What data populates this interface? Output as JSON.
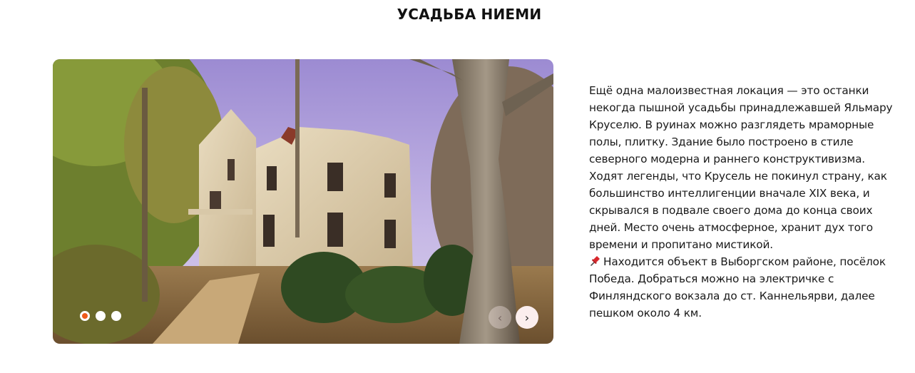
{
  "title": "УСАДЬБА НИЕМИ",
  "slider": {
    "slide_count": 3,
    "active_index": 0,
    "prev_label": "‹",
    "next_label": "›"
  },
  "description": {
    "paragraph_1": "Ещё одна малоизвестная локация — это останки некогда пышной усадьбы принадлежавшей Яльмару Круселю. В руинах можно разглядеть мраморные полы, плитку. Здание было построено в стиле северного модерна и раннего конструктивизма. Ходят легенды, что Крусель не покинул страну, как большинство интеллигенции вначале XIX века, и скрывался в подвале своего дома до конца своих дней. Место очень атмосферное, хранит дух того времени и пропитано мистикой.",
    "paragraph_2": "Находится объект в Выборгском районе, посёлок Победа. Добраться можно на электричке с Финляндского вокзала до ст. Каннельярви, далее пешком около 4 км.",
    "pin_icon": "pushpin-icon"
  },
  "colors": {
    "accent": "#ee5a1a",
    "text": "#1a1a1a"
  }
}
